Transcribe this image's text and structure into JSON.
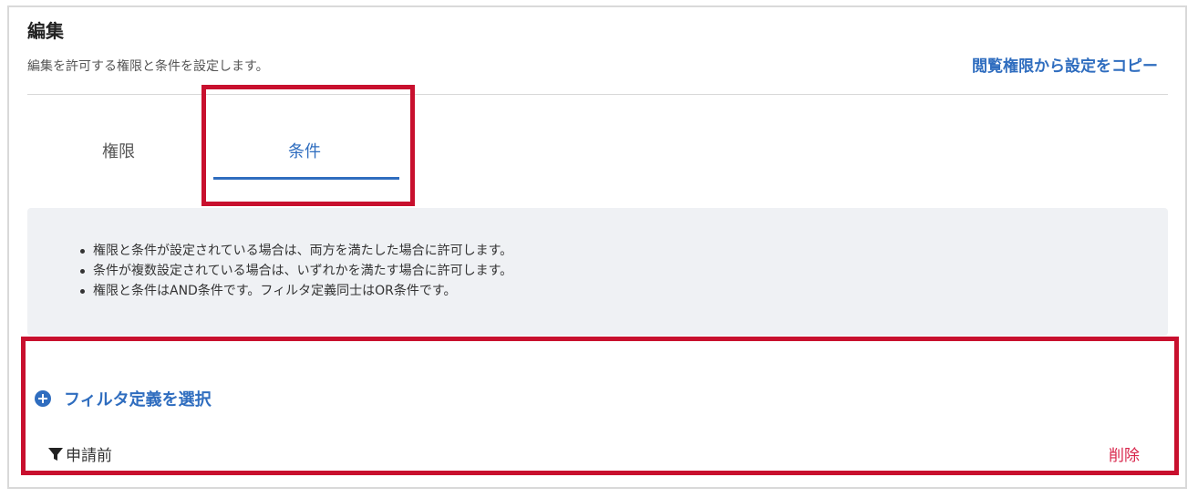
{
  "panel": {
    "title": "編集",
    "subtitle": "編集を許可する権限と条件を設定します。",
    "copy_link": "閲覧権限から設定をコピー"
  },
  "tabs": [
    {
      "label": "権限",
      "active": false
    },
    {
      "label": "条件",
      "active": true
    }
  ],
  "info": {
    "items": [
      "権限と条件が設定されている場合は、両方を満たした場合に許可します。",
      "条件が複数設定されている場合は、いずれかを満たす場合に許可します。",
      "権限と条件はAND条件です。フィルタ定義同士はOR条件です。"
    ]
  },
  "filter": {
    "select_label": "フィルタ定義を選択",
    "items": [
      {
        "name": "申請前",
        "delete_label": "削除"
      }
    ]
  },
  "colors": {
    "accent": "#2f6dbf",
    "danger": "#d8244a",
    "highlight": "#c8102e",
    "info_bg": "#eff1f4"
  },
  "icons": {
    "add": "plus-circle-icon",
    "filter": "funnel-icon"
  }
}
